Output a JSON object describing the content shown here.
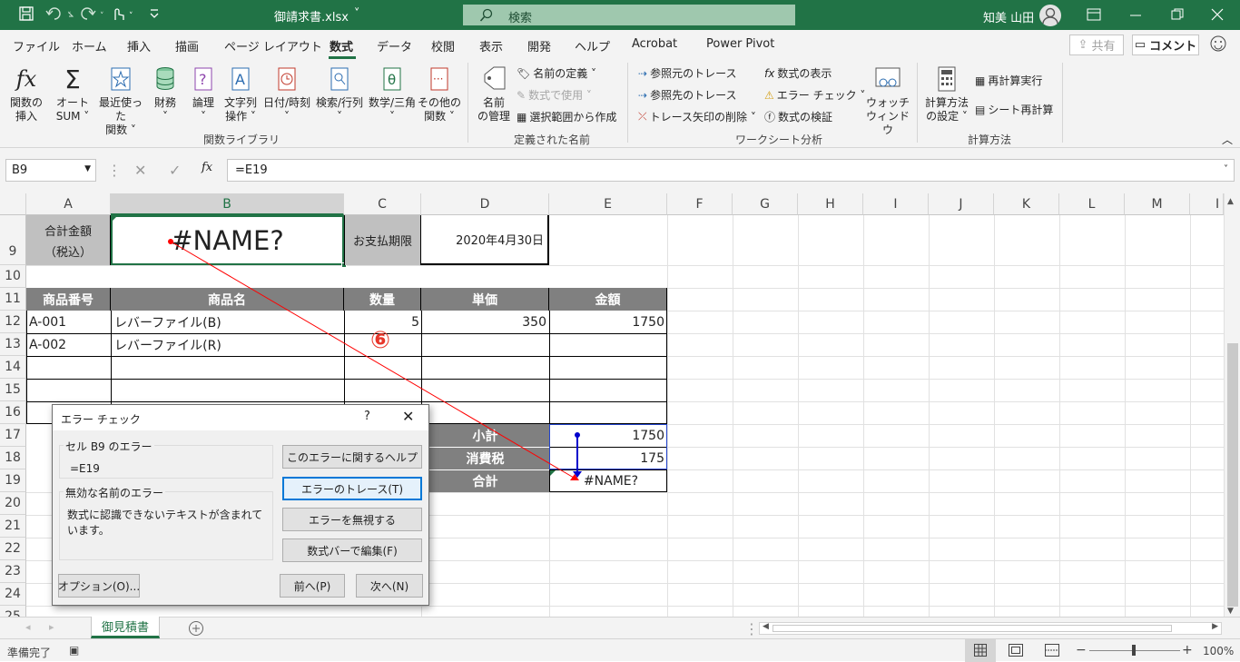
{
  "window": {
    "filename": "御請求書.xlsx",
    "search_placeholder": "検索",
    "user_name": "知美 山田"
  },
  "colors": {
    "accent": "#217346",
    "header_fill": "#808080",
    "label_fill": "#c0c0c0",
    "trace_red": "#ff0000",
    "trace_blue": "#0000cc"
  },
  "ribbon_tabs": [
    "ファイル",
    "ホーム",
    "挿入",
    "描画",
    "ページ レイアウト",
    "数式",
    "データ",
    "校閲",
    "表示",
    "開発",
    "ヘルプ",
    "Acrobat",
    "Power Pivot"
  ],
  "active_tab": "数式",
  "share_label": "共有",
  "comment_label": "コメント",
  "ribbon": {
    "insert_function": [
      "関数の",
      "挿入"
    ],
    "autosum": [
      "オート",
      "SUM ˅"
    ],
    "recent": [
      "最近使った",
      "関数 ˅"
    ],
    "financial": [
      "財務",
      "˅"
    ],
    "logical": [
      "論理",
      "˅"
    ],
    "text": [
      "文字列",
      "操作 ˅"
    ],
    "datetime": [
      "日付/時刻",
      "˅"
    ],
    "lookup": [
      "検索/行列",
      "˅"
    ],
    "math": [
      "数学/三角",
      "˅"
    ],
    "more": [
      "その他の",
      "関数 ˅"
    ],
    "group_function_library": "関数ライブラリ",
    "name_manager": [
      "名前",
      "の管理"
    ],
    "define_name": "名前の定義 ˅",
    "use_in_formula": "数式で使用 ˅",
    "create_from_selection": "選択範囲から作成",
    "group_defined_names": "定義された名前",
    "trace_precedents": "参照元のトレース",
    "trace_dependents": "参照先のトレース",
    "remove_arrows": "トレース矢印の削除 ˅",
    "show_formulas": "数式の表示",
    "error_checking": "エラー チェック ˅",
    "evaluate_formula": "数式の検証",
    "watch_window": [
      "ウォッチ",
      "ウィンドウ"
    ],
    "group_formula_auditing": "ワークシート分析",
    "calc_options": [
      "計算方法",
      "の設定 ˅"
    ],
    "calc_now": "再計算実行",
    "calc_sheet": "シート再計算",
    "group_calculation": "計算方法"
  },
  "formula_bar": {
    "name_box": "B9",
    "formula": "=E19",
    "fx": "fx"
  },
  "columns": [
    "A",
    "B",
    "C",
    "D",
    "E",
    "F",
    "G",
    "H",
    "I",
    "J",
    "K",
    "L",
    "M",
    "I"
  ],
  "rows": [
    "9",
    "10",
    "11",
    "12",
    "13",
    "14",
    "15",
    "16",
    "17",
    "18",
    "19",
    "20",
    "21",
    "22",
    "23",
    "24",
    "25"
  ],
  "cells": {
    "total_label_1": "合計金額",
    "total_label_2": "（税込）",
    "b9": "#NAME?",
    "due_label": "お支払期限",
    "due_date": "2020年4月30日",
    "headers": [
      "商品番号",
      "商品名",
      "数量",
      "単価",
      "金額"
    ],
    "items": [
      {
        "code": "A-001",
        "name": "レバーファイル(B)",
        "qty": "5",
        "price": "350",
        "amount": "1750"
      },
      {
        "code": "A-002",
        "name": "レバーファイル(R)",
        "qty": "",
        "price": "",
        "amount": ""
      }
    ],
    "subtotal_label": "小計",
    "subtotal": "1750",
    "tax_label": "消費税",
    "tax": "175",
    "total_label": "合計",
    "total": "#NAME?"
  },
  "marker": "⑥",
  "dialog": {
    "title": "エラー チェック",
    "help_glyph": "?",
    "error_location": "セル B9 のエラー",
    "formula": "=E19",
    "error_title": "無効な名前のエラー",
    "error_desc": "数式に認識できないテキストが含まれています。",
    "btn_help": "このエラーに関するヘルプ",
    "btn_trace": "エラーのトレース(T)",
    "btn_ignore": "エラーを無視する",
    "btn_edit": "数式バーで編集(F)",
    "btn_options": "オプション(O)...",
    "btn_prev": "前へ(P)",
    "btn_next": "次へ(N)"
  },
  "sheet_tab": "御見積書",
  "status": {
    "ready": "準備完了",
    "zoom": "100%"
  }
}
